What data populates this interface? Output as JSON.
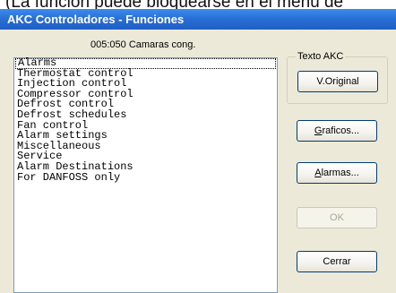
{
  "caption": "(La función puede bloquearse en el menú de",
  "window": {
    "title": "AKC Controladores - Funciones",
    "subtitle": "005:050  Camaras cong."
  },
  "list": {
    "items": [
      "Alarms",
      "Thermostat control",
      "Injection control",
      "Compressor control",
      "Defrost control",
      "Defrost schedules",
      "Fan control",
      "Alarm settings",
      "Miscellaneous",
      "Service",
      "Alarm Destinations",
      "For DANFOSS only"
    ],
    "selected": "Alarms"
  },
  "group": {
    "label": "Texto AKC"
  },
  "buttons": {
    "original": "V.Original",
    "graficos_first": "G",
    "graficos_rest": "raficos...",
    "alarmas_first": "A",
    "alarmas_rest": "larmas...",
    "ok": "OK",
    "cerrar": "Cerrar"
  },
  "colors": {
    "titlebar": "#2a6fd6",
    "dialog_bg": "#ece9d8"
  }
}
